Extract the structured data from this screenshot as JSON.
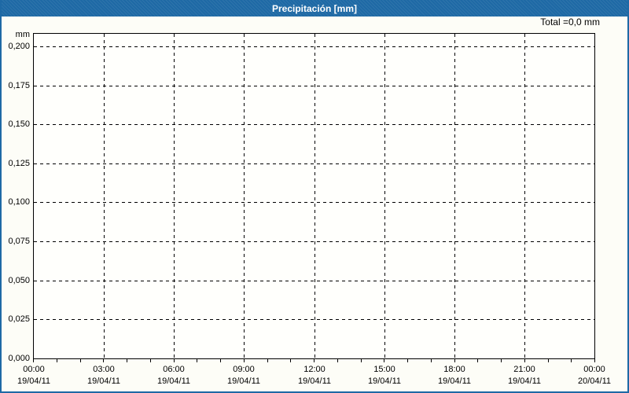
{
  "title_bar": {
    "label": "Precipitación [mm]"
  },
  "total_label": "Total =0,0 mm",
  "colors": {
    "titlebar_blue": "#1e69a5",
    "frame_border_blue": "#1e69a5",
    "titlebar_text": "#ffffff",
    "background": "#fdfdf7",
    "plot_background": "#fffffc",
    "grid_and_text": "#000000"
  },
  "chart_data": {
    "type": "line",
    "title": "Precipitación [mm]",
    "ylabel": "mm",
    "xlabel": "",
    "total_annotation": "Total =0,0 mm",
    "grid": "dashed",
    "legend_position": "none",
    "ylim": [
      0,
      0.208
    ],
    "y_tick_values": [
      0.2,
      0.175,
      0.15,
      0.125,
      0.1,
      0.075,
      0.05,
      0.025,
      0.0
    ],
    "y_tick_labels": [
      "0,200",
      "0,175",
      "0,150",
      "0,125",
      "0,100",
      "0,075",
      "0,050",
      "0,025",
      "0,000"
    ],
    "x_axis": {
      "span_hours": 24,
      "major_gridline_every_hours": 3,
      "minor_tick_every_hours": 1,
      "labels": [
        {
          "hour": 0,
          "time": "00:00",
          "date": "19/04/11"
        },
        {
          "hour": 3,
          "time": "03:00",
          "date": "19/04/11"
        },
        {
          "hour": 6,
          "time": "06:00",
          "date": "19/04/11"
        },
        {
          "hour": 9,
          "time": "09:00",
          "date": "19/04/11"
        },
        {
          "hour": 12,
          "time": "12:00",
          "date": "19/04/11"
        },
        {
          "hour": 15,
          "time": "15:00",
          "date": "19/04/11"
        },
        {
          "hour": 18,
          "time": "18:00",
          "date": "19/04/11"
        },
        {
          "hour": 21,
          "time": "21:00",
          "date": "19/04/11"
        },
        {
          "hour": 24,
          "time": "00:00",
          "date": "20/04/11"
        }
      ]
    },
    "series": []
  }
}
